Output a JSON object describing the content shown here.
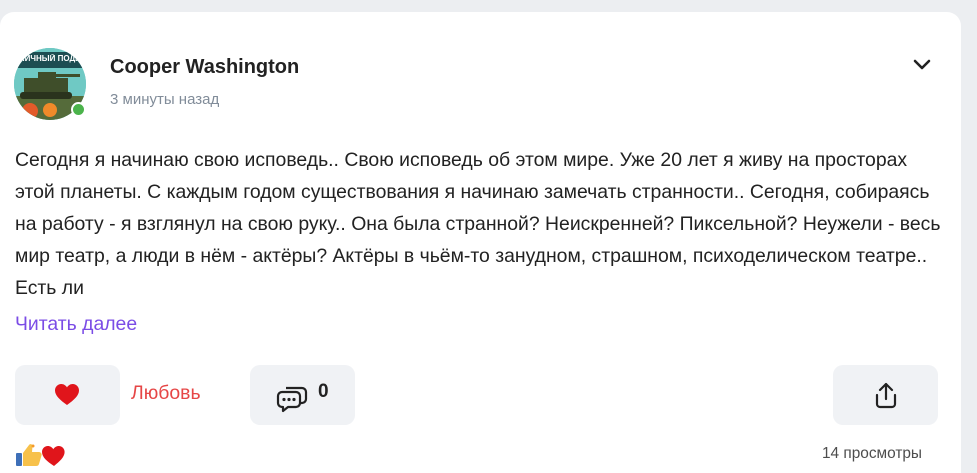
{
  "post": {
    "author": "Cooper Washington",
    "time": "3 минуты назад",
    "avatar_text": "ЛИЧНЫЙ ПОДВ",
    "text": "Сегодня я начинаю свою исповедь.. Свою исповедь об этом мире. Уже 20 лет я живу на просторах этой планеты. С каждым годом существования я начинаю замечать странности.. Сегодня, собираясь на работу - я взглянул на свою руку.. Она была странной? Неискренней? Пиксельной? Неужели - весь мир театр, а люди в нём - актёры? Актёры в чьём-то занудном, страшном, психоделическом театре.. Есть ли",
    "read_more": "Читать далее"
  },
  "actions": {
    "like_label": "Любовь",
    "comment_count": "0"
  },
  "footer": {
    "views": "14 просмотры"
  },
  "icons": {
    "menu": "chevron-down-icon",
    "like": "heart-icon",
    "comment": "comment-icon",
    "share": "share-icon",
    "reactions": [
      "thumbs-up-icon",
      "heart-icon"
    ]
  },
  "colors": {
    "accent": "#7b4ce6",
    "like": "#e64646",
    "online": "#4bb34b"
  }
}
